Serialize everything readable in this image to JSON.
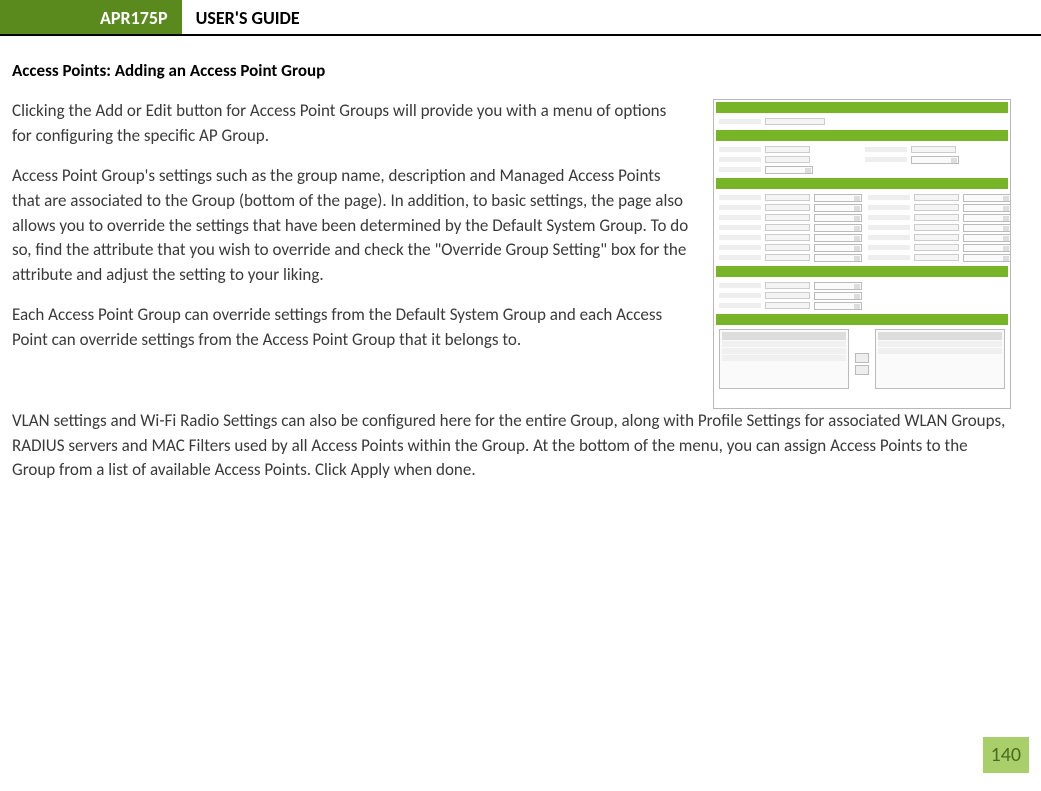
{
  "header": {
    "model": "APR175P",
    "guide": "USER'S GUIDE"
  },
  "section_title": "Access Points: Adding an Access Point Group",
  "paragraphs": {
    "p1": "Clicking the Add or Edit button for Access Point Groups will provide you with a menu of options for configuring the specific AP Group.",
    "p2": "Access Point Group's settings such as the group name, description and Managed Access Points that are associated to the Group (bottom of the page).  In addition, to basic settings, the page also allows you to override the settings that have been determined by the Default System Group.  To do so, find the attribute that you wish to override and check the \"Override Group Setting\" box for the attribute and adjust the setting to your liking.",
    "p3": "Each Access Point Group can override settings from the Default System Group and each Access Point can override settings from the Access Point Group that it belongs to.",
    "p4": "VLAN settings and Wi-Fi Radio Settings can also be configured here for the entire Group, along with Profile Settings for associated WLAN Groups, RADIUS servers and MAC Filters used by all Access Points within the Group. At the bottom of the menu, you can assign Access Points to the Group from a list of available Access Points. Click Apply when done."
  },
  "page_number": "140"
}
